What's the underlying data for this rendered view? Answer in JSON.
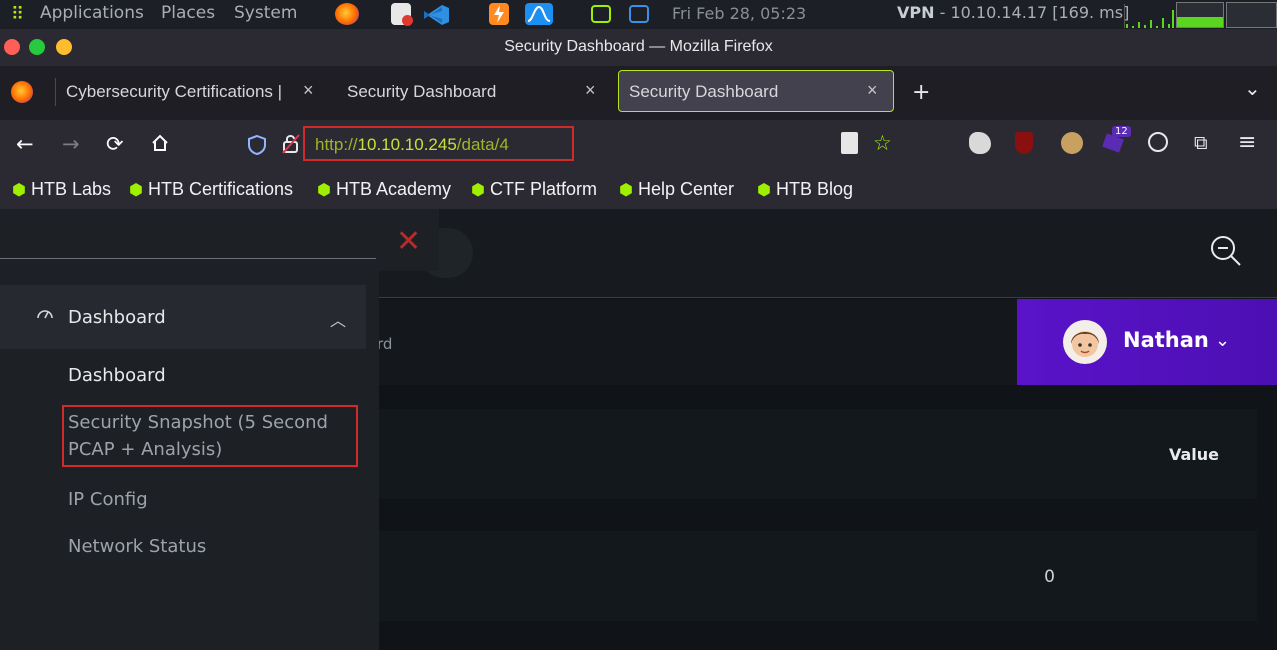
{
  "system_bar": {
    "menu": [
      "Applications",
      "Places",
      "System"
    ],
    "datetime": "Fri Feb 28, 05:23",
    "vpn_label": "VPN",
    "vpn_value": " - 10.10.14.17 [169. ms]"
  },
  "window": {
    "title": "Security Dashboard — Mozilla Firefox"
  },
  "tabs": [
    {
      "label": "Cybersecurity Certifications |",
      "close": "×"
    },
    {
      "label": "Security Dashboard",
      "close": "×"
    },
    {
      "label": "Security Dashboard",
      "close": "×"
    }
  ],
  "tabstrip": {
    "new_tab": "+",
    "list_all": "⌄"
  },
  "address_bar": {
    "url_scheme": "http://",
    "url_host": "10.10.10.245",
    "url_path": "/data/4"
  },
  "extensions": {
    "badge_count": "12"
  },
  "bookmarks": [
    "HTB Labs",
    "HTB Certifications",
    "HTB Academy",
    "CTF Platform",
    "Help Center",
    "HTB Blog"
  ],
  "sidebar": {
    "group_label": "Dashboard",
    "items": [
      {
        "label": "Dashboard"
      },
      {
        "label": "Security Snapshot (5 Second",
        "label_line2": "PCAP + Analysis)"
      },
      {
        "label": "IP Config"
      },
      {
        "label": "Network Status"
      }
    ]
  },
  "page": {
    "breadcrumb_fragment": "rd",
    "user_name": "Nathan",
    "table_header_value": "Value",
    "table_cell_value": "0"
  },
  "colors": {
    "accent_lime": "#9fef00",
    "highlight_red": "#d12a2a",
    "user_purple": "#5a13c9"
  }
}
